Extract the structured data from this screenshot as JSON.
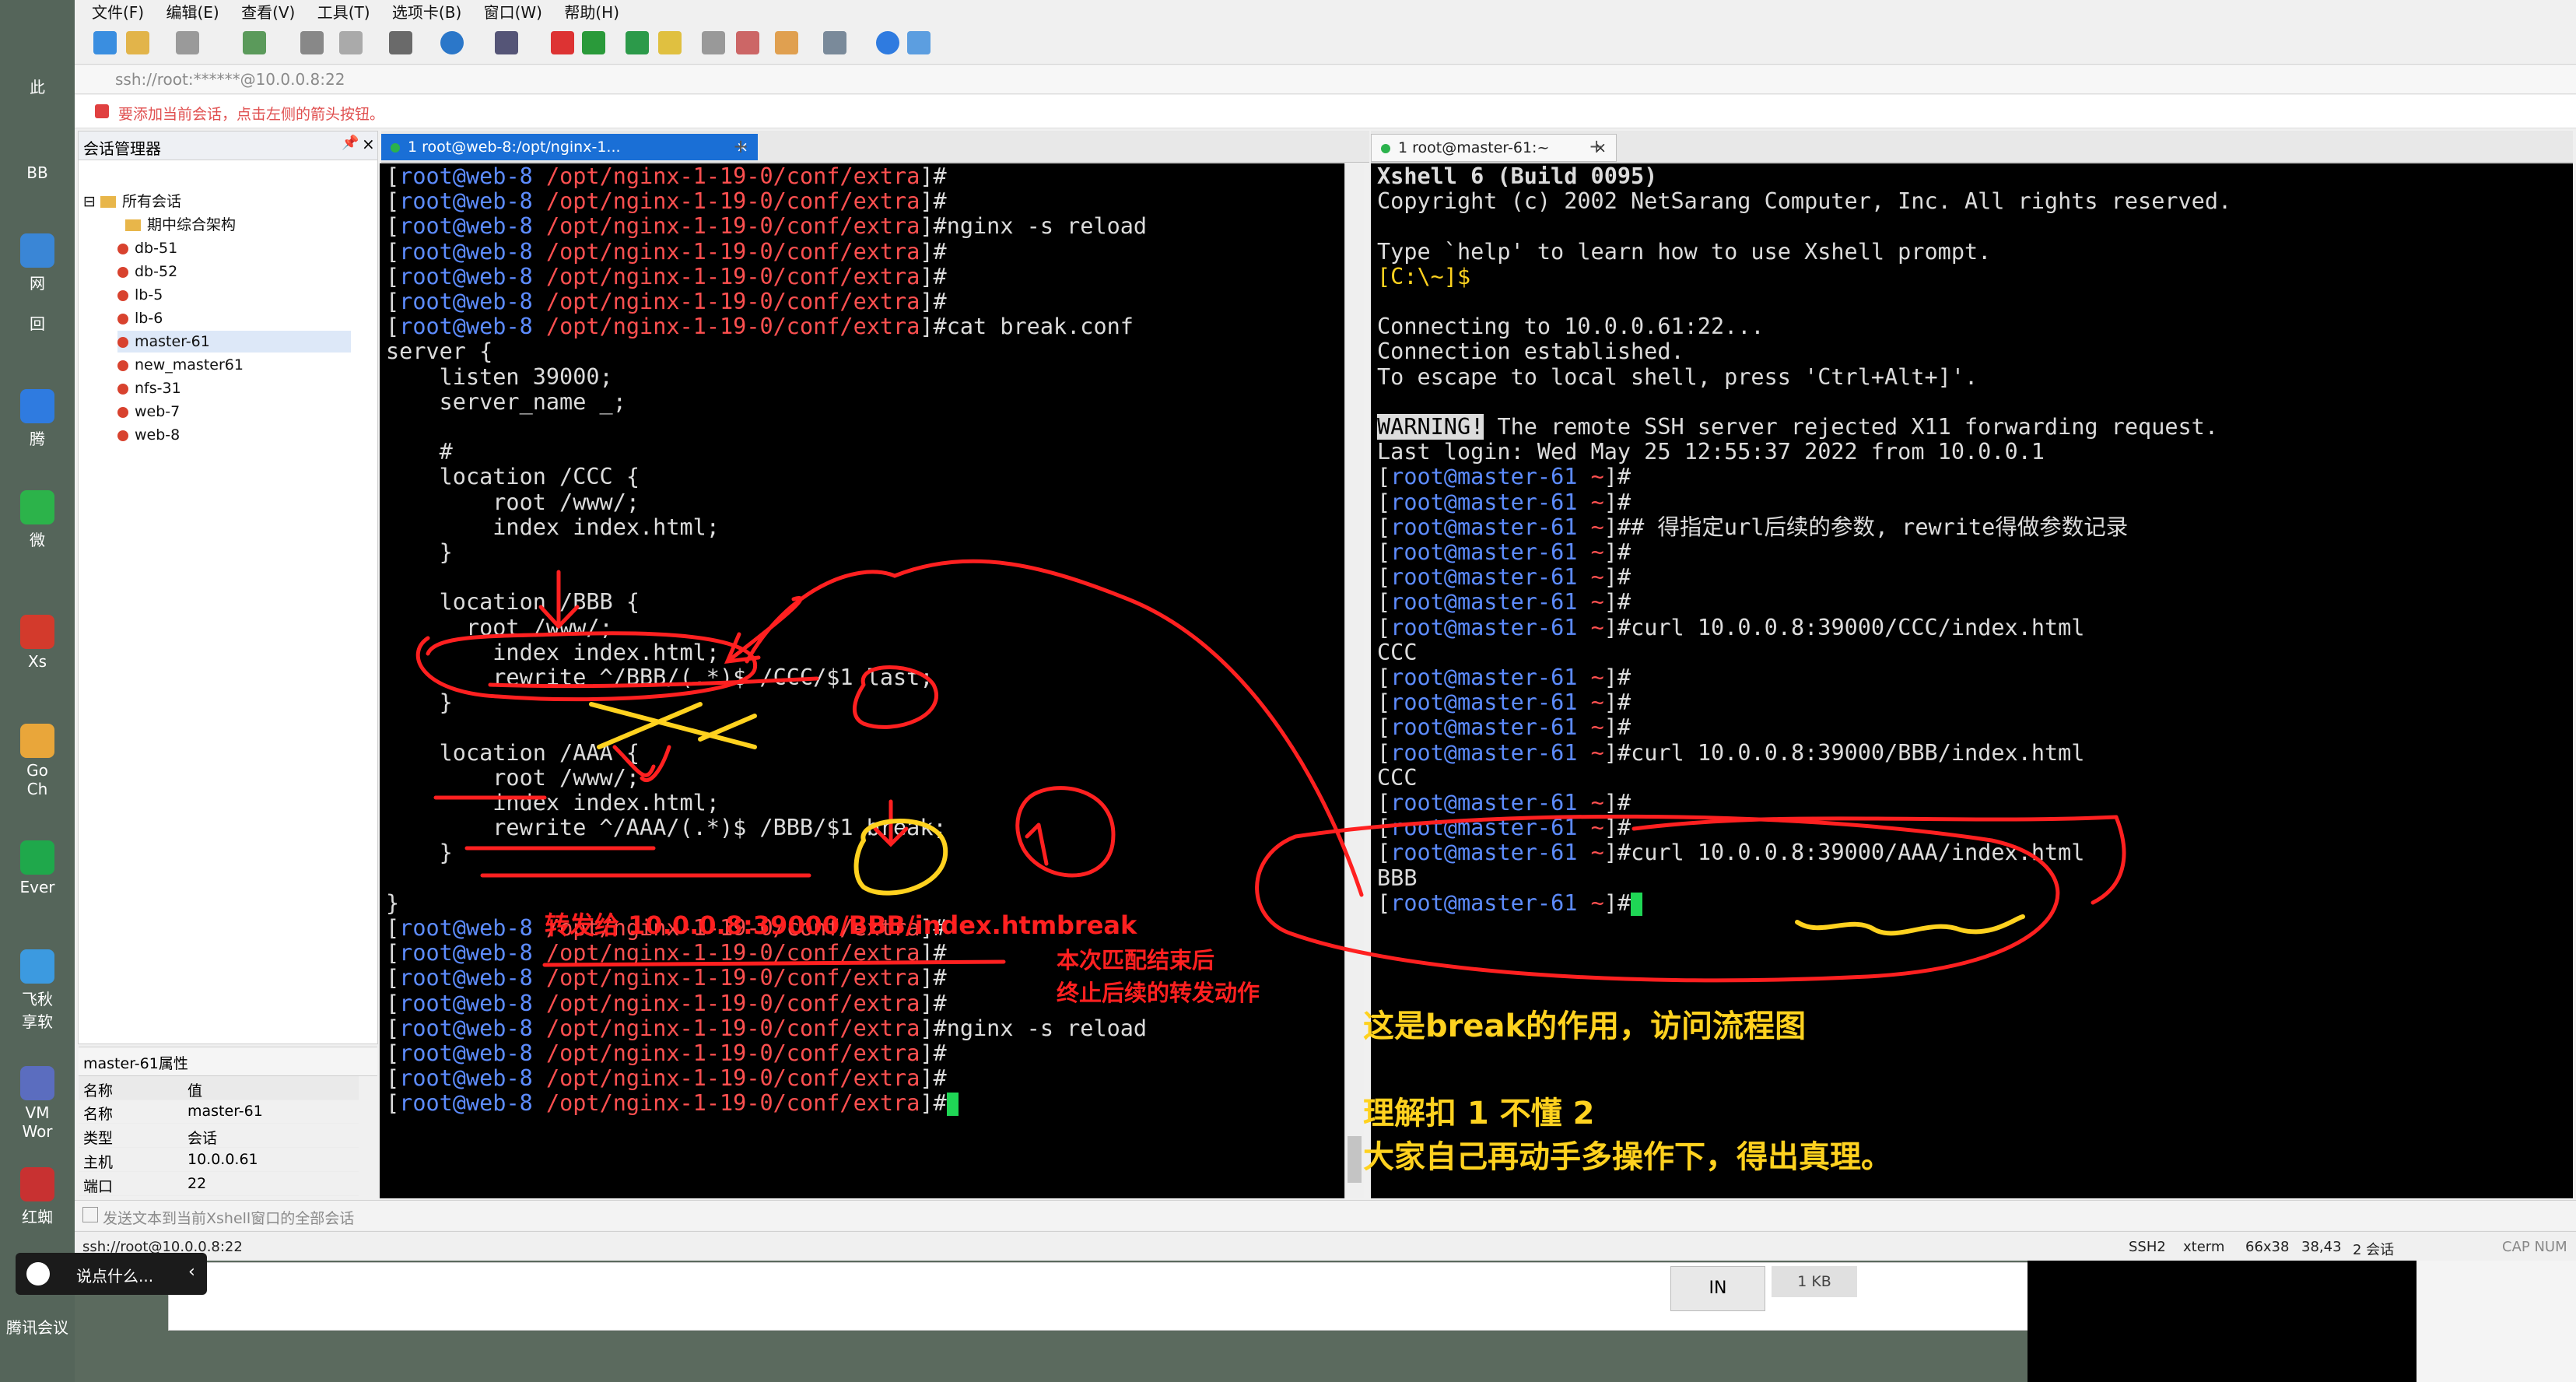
{
  "desktop": {
    "items": [
      "此",
      "BB",
      "网",
      "回",
      "腾",
      "微",
      "Xs",
      "Go\nCh",
      "Ever",
      "飞秋\n享软",
      "VM\nWor",
      "红蜘",
      "腾讯会议"
    ]
  },
  "menu": [
    "文件(F)",
    "编辑(E)",
    "查看(V)",
    "工具(T)",
    "选项卡(B)",
    "窗口(W)",
    "帮助(H)"
  ],
  "address": "ssh://root:******@10.0.0.8:22",
  "hint": "要添加当前会话，点击左侧的箭头按钮。",
  "session_manager": {
    "title": "会话管理器",
    "root": "所有会话",
    "folder": "期中综合架构",
    "sessions": [
      "db-51",
      "db-52",
      "lb-5",
      "lb-6",
      "master-61",
      "new_master61",
      "nfs-31",
      "web-7",
      "web-8"
    ],
    "selected": "master-61"
  },
  "properties": {
    "title": "master-61属性",
    "header": [
      "名称",
      "值"
    ],
    "rows": [
      {
        "k": "名称",
        "v": "master-61"
      },
      {
        "k": "类型",
        "v": "会话"
      },
      {
        "k": "主机",
        "v": "10.0.0.61"
      },
      {
        "k": "端口",
        "v": "22"
      }
    ]
  },
  "tabs": {
    "left": "1 root@web-8:/opt/nginx-1...",
    "right": "1 root@master-61:~"
  },
  "left_terminal": {
    "prompt_user": "root@web-8",
    "prompt_path": "/opt/nginx-1-19-0/conf/extra",
    "lines": [
      {
        "type": "prompt",
        "cmd": "#"
      },
      {
        "type": "prompt",
        "cmd": "#"
      },
      {
        "type": "prompt",
        "cmd": "#nginx -s reload"
      },
      {
        "type": "prompt",
        "cmd": "#"
      },
      {
        "type": "prompt",
        "cmd": "#"
      },
      {
        "type": "prompt",
        "cmd": "#"
      },
      {
        "type": "prompt",
        "cmd": "#cat break.conf"
      },
      {
        "type": "text",
        "text": "server {"
      },
      {
        "type": "text",
        "text": "    listen 39000;"
      },
      {
        "type": "text",
        "text": "    server_name _;"
      },
      {
        "type": "text",
        "text": ""
      },
      {
        "type": "text",
        "text": "    #"
      },
      {
        "type": "text",
        "text": "    location /CCC {"
      },
      {
        "type": "text",
        "text": "        root /www/;"
      },
      {
        "type": "text",
        "text": "        index index.html;"
      },
      {
        "type": "text",
        "text": "    }"
      },
      {
        "type": "text",
        "text": ""
      },
      {
        "type": "text",
        "text": "    location /BBB {"
      },
      {
        "type": "text",
        "text": "      root /www/;"
      },
      {
        "type": "text",
        "text": "        index index.html;"
      },
      {
        "type": "text",
        "text": "        rewrite ^/BBB/(.*)$ /CCC/$1 last;"
      },
      {
        "type": "text",
        "text": "    }"
      },
      {
        "type": "text",
        "text": ""
      },
      {
        "type": "text",
        "text": "    location /AAA {"
      },
      {
        "type": "text",
        "text": "        root /www/;"
      },
      {
        "type": "text",
        "text": "        index index.html;"
      },
      {
        "type": "text",
        "text": "        rewrite ^/AAA/(.*)$ /BBB/$1 break;"
      },
      {
        "type": "text",
        "text": "    }"
      },
      {
        "type": "text",
        "text": ""
      },
      {
        "type": "text",
        "text": "}"
      },
      {
        "type": "prompt",
        "cmd": "#"
      },
      {
        "type": "prompt",
        "cmd": "#"
      },
      {
        "type": "prompt",
        "cmd": "#"
      },
      {
        "type": "prompt",
        "cmd": "#"
      },
      {
        "type": "prompt",
        "cmd": "#nginx -s reload"
      },
      {
        "type": "prompt",
        "cmd": "#"
      },
      {
        "type": "prompt",
        "cmd": "#"
      },
      {
        "type": "prompt",
        "cmd": "#",
        "cursor": true
      }
    ]
  },
  "right_terminal": {
    "prompt_user": "root@master-61",
    "prompt_path": "~",
    "lines": [
      {
        "type": "bold",
        "text": "Xshell 6 (Build 0095)"
      },
      {
        "type": "text",
        "text": "Copyright (c) 2002 NetSarang Computer, Inc. All rights reserved."
      },
      {
        "type": "text",
        "text": ""
      },
      {
        "type": "text",
        "text": "Type `help' to learn how to use Xshell prompt."
      },
      {
        "type": "local",
        "text": "[C:\\~]$"
      },
      {
        "type": "text",
        "text": ""
      },
      {
        "type": "text",
        "text": "Connecting to 10.0.0.61:22..."
      },
      {
        "type": "text",
        "text": "Connection established."
      },
      {
        "type": "text",
        "text": "To escape to local shell, press 'Ctrl+Alt+]'."
      },
      {
        "type": "text",
        "text": ""
      },
      {
        "type": "warn",
        "badge": "WARNING!",
        "text": " The remote SSH server rejected X11 forwarding request."
      },
      {
        "type": "text",
        "text": "Last login: Wed May 25 12:55:37 2022 from 10.0.0.1"
      },
      {
        "type": "prompt",
        "cmd": "#"
      },
      {
        "type": "prompt",
        "cmd": "#"
      },
      {
        "type": "prompt",
        "cmd": "## 得指定url后续的参数, rewrite得做参数记录"
      },
      {
        "type": "prompt",
        "cmd": "#"
      },
      {
        "type": "prompt",
        "cmd": "#"
      },
      {
        "type": "prompt",
        "cmd": "#"
      },
      {
        "type": "prompt",
        "cmd": "#curl 10.0.0.8:39000/CCC/index.html"
      },
      {
        "type": "text",
        "text": "CCC"
      },
      {
        "type": "prompt",
        "cmd": "#"
      },
      {
        "type": "prompt",
        "cmd": "#"
      },
      {
        "type": "prompt",
        "cmd": "#"
      },
      {
        "type": "prompt",
        "cmd": "#curl 10.0.0.8:39000/BBB/index.html"
      },
      {
        "type": "text",
        "text": "CCC"
      },
      {
        "type": "prompt",
        "cmd": "#"
      },
      {
        "type": "prompt",
        "cmd": "#"
      },
      {
        "type": "prompt",
        "cmd": "#curl 10.0.0.8:39000/AAA/index.html"
      },
      {
        "type": "text",
        "text": "BBB"
      },
      {
        "type": "prompt",
        "cmd": "#",
        "cursor": true
      }
    ]
  },
  "annotations": {
    "forward": "转发给 10.0.0.8:39000/BBB/index.html",
    "break_title": "break",
    "break_line1": "本次匹配结束后",
    "break_line2": "终止后续的转发动作",
    "yellow1": "这是break的作用，访问流程图",
    "yellow2": "理解扣 1 不懂 2",
    "yellow3": "大家自己再动手多操作下，得出真理。"
  },
  "send_bar": "发送文本到当前Xshell窗口的全部会话",
  "status": {
    "left": "ssh://root@10.0.0.8:22",
    "proto": "SSH2",
    "term": "xterm",
    "size": "66x38",
    "pos": "38,43",
    "sessions": "2 会话",
    "caps": "CAP NUM"
  },
  "chat": {
    "placeholder": "说点什么..."
  },
  "bottom": {
    "in": "IN",
    "size": "1 KB"
  },
  "colors": {
    "prompt_user": "#5d8cff",
    "prompt_path": "#ff5050",
    "annotation_red": "#ff2020",
    "annotation_yellow": "#ffd21f"
  }
}
